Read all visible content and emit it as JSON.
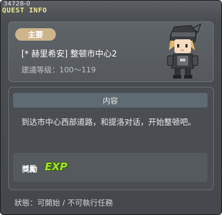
{
  "window": {
    "quest_id": "34728-0",
    "title": "QUEST INFO"
  },
  "summary": {
    "type_label": "主要",
    "quest_name": "[* 赫里希安] 整顿市中心2",
    "level_range": "建議等级：100～119"
  },
  "content": {
    "header": "内容",
    "text": "到达市中心西部道路，和提洛对话，开始整顿吧。"
  },
  "reward": {
    "label": "獎勵",
    "exp_text": "EXP"
  },
  "status": {
    "text": "狀態：可開始 / 不可執行任務"
  },
  "colors": {
    "window_bg": "#4a4e52",
    "title_yellow": "#f0e68c",
    "pill_tan": "#cdb48b",
    "exp_green": "#a6e32a"
  },
  "icons": {
    "avatar": "character-avatar",
    "reward": "exp-icon"
  }
}
